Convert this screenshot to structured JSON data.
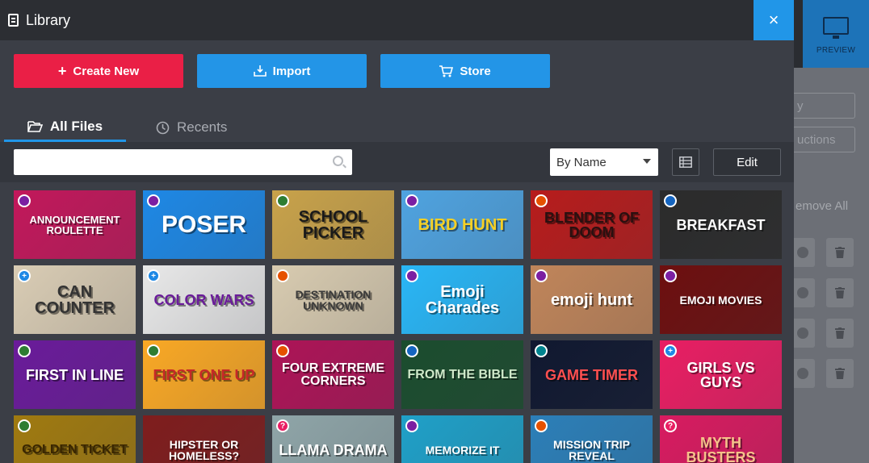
{
  "modal": {
    "title": "Library",
    "close_label": "×"
  },
  "actions": {
    "create_label": "Create New",
    "import_label": "Import",
    "store_label": "Store"
  },
  "tabs": {
    "all_label": "All Files",
    "recents_label": "Recents"
  },
  "toolbar": {
    "search_placeholder": "",
    "search_value": "",
    "sort_value": "By Name",
    "edit_label": "Edit"
  },
  "background_app": {
    "preview_label": "PREVIEW",
    "btn1_partial": "y",
    "btn2_partial": "uctions",
    "remove_all_partial": "emove All"
  },
  "colors": {
    "accent_blue": "#2196e8",
    "create_red": "#ea1f46",
    "modal_bg": "#3b3e46"
  },
  "tiles": [
    {
      "label": "ANNOUNCEMENT ROULETTE",
      "bg": "#c2185b",
      "fg": "#ffffff",
      "badge": "purple",
      "size": 13
    },
    {
      "label": "POSER",
      "bg": "#1e88e5",
      "fg": "#ffffff",
      "badge": "purple",
      "size": 30
    },
    {
      "label": "SCHOOL PICKER",
      "bg": "#c8a24a",
      "fg": "#1a1a1a",
      "badge": "green",
      "size": 20
    },
    {
      "label": "BIRD HUNT",
      "bg": "#4fa3e0",
      "fg": "#f6d024",
      "badge": "purple",
      "size": 20
    },
    {
      "label": "BLENDER OF DOOM",
      "bg": "#b71c1c",
      "fg": "#2a1010",
      "badge": "multi",
      "size": 18
    },
    {
      "label": "BREAKFAST",
      "bg": "#2b2b2b",
      "fg": "#ffffff",
      "badge": "blue",
      "size": 18
    },
    {
      "label": "CAN COUNTER",
      "bg": "#d9ccb4",
      "fg": "#333333",
      "badge": "plus",
      "size": 20
    },
    {
      "label": "COLOR WARS",
      "bg": "#e8e8e8",
      "fg": "#6a1b9a",
      "badge": "plus",
      "size": 18
    },
    {
      "label": "DESTINATION UNKNOWN",
      "bg": "#d8cbb0",
      "fg": "#3a3a3a",
      "badge": "multi",
      "size": 14
    },
    {
      "label": "Emoji Charades",
      "bg": "#29b6f6",
      "fg": "#ffffff",
      "badge": "purple",
      "size": 20
    },
    {
      "label": "emoji hunt",
      "bg": "#c0855a",
      "fg": "#ffffff",
      "badge": "purple",
      "size": 20
    },
    {
      "label": "EMOJI MOVIES",
      "bg": "#6d0f0f",
      "fg": "#ffffff",
      "badge": "purple",
      "size": 14
    },
    {
      "label": "FIRST IN LINE",
      "bg": "#6a1b9a",
      "fg": "#ffffff",
      "badge": "green",
      "size": 18
    },
    {
      "label": "FIRST ONE UP",
      "bg": "#f9a825",
      "fg": "#c62828",
      "badge": "green",
      "size": 18
    },
    {
      "label": "FOUR EXTREME CORNERS",
      "bg": "#ad1457",
      "fg": "#ffffff",
      "badge": "multi",
      "size": 16
    },
    {
      "label": "FROM THE BIBLE",
      "bg": "#1b4d2e",
      "fg": "#cfe8c9",
      "badge": "blue",
      "size": 16
    },
    {
      "label": "GAME TIMER",
      "bg": "#101830",
      "fg": "#ff4f4f",
      "badge": "timer",
      "size": 18
    },
    {
      "label": "GIRLS VS GUYS",
      "bg": "#e91e63",
      "fg": "#ffffff",
      "badge": "plus",
      "size": 18
    },
    {
      "label": "GOLDEN TICKET",
      "bg": "#a07a10",
      "fg": "#3a2600",
      "badge": "green",
      "size": 16
    },
    {
      "label": "HIPSTER OR HOMELESS?",
      "bg": "#7f1d1d",
      "fg": "#ffffff",
      "badge": "",
      "size": 14
    },
    {
      "label": "LLAMA DRAMA",
      "bg": "#8fa5a8",
      "fg": "#ffffff",
      "badge": "q",
      "size": 18
    },
    {
      "label": "MEMORIZE IT",
      "bg": "#1fa0c8",
      "fg": "#ffffff",
      "badge": "purple",
      "size": 14
    },
    {
      "label": "MISSION TRIP REVEAL",
      "bg": "#2c7fb8",
      "fg": "#ffffff",
      "badge": "multi",
      "size": 14
    },
    {
      "label": "MYTH BUSTERS",
      "bg": "#d81b60",
      "fg": "#f5c28a",
      "badge": "q",
      "size": 18
    }
  ]
}
